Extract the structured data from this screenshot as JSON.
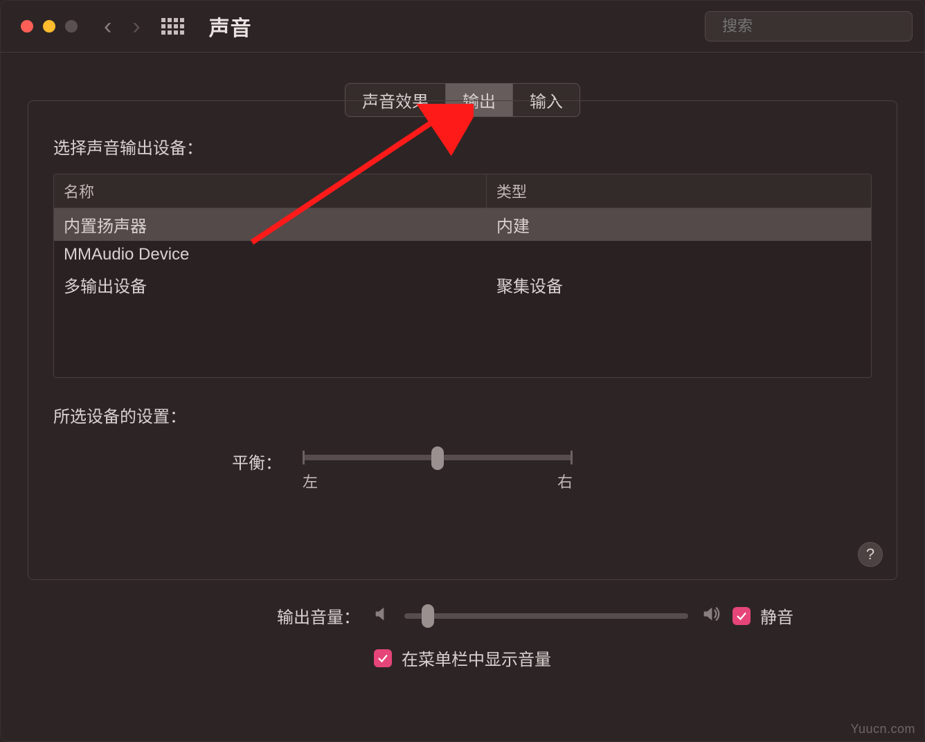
{
  "header": {
    "title": "声音",
    "search_placeholder": "搜索"
  },
  "tabs": {
    "items": [
      "声音效果",
      "输出",
      "输入"
    ],
    "active_index": 1
  },
  "output_section": {
    "choose_label": "选择声音输出设备：",
    "columns": {
      "name": "名称",
      "type": "类型"
    },
    "devices": [
      {
        "name": "内置扬声器",
        "type": "内建",
        "selected": true
      },
      {
        "name": "MMAudio Device",
        "type": "",
        "selected": false
      },
      {
        "name": "多输出设备",
        "type": "聚集设备",
        "selected": false
      }
    ],
    "settings_label": "所选设备的设置：",
    "balance": {
      "label": "平衡：",
      "left": "左",
      "right": "右",
      "value": 0.5
    }
  },
  "footer": {
    "volume_label": "输出音量：",
    "volume_value": 0.06,
    "mute_label": "静音",
    "mute_checked": true,
    "show_in_menubar_label": "在菜单栏中显示音量",
    "show_in_menubar_checked": true
  },
  "help_label": "?",
  "watermark": "Yuucn.com"
}
